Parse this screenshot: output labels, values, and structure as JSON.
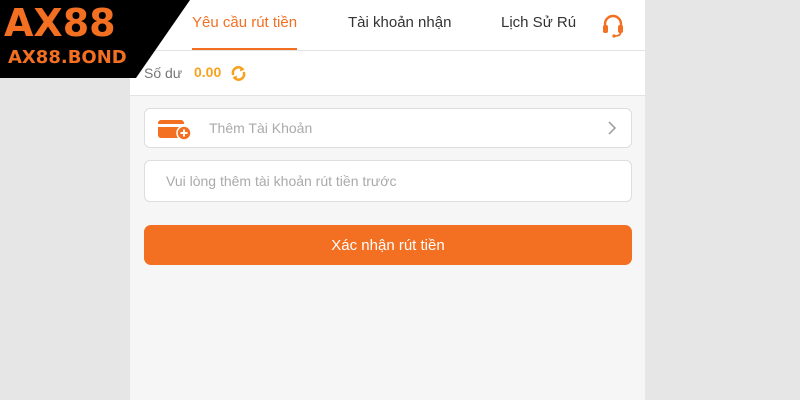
{
  "brand": {
    "logo": "AX88",
    "site": "AX88.BOND"
  },
  "tabs": [
    {
      "label": "Yêu cầu rút tiền",
      "active": true
    },
    {
      "label": "Tài khoản nhận",
      "active": false
    },
    {
      "label": "Lịch Sử Rú",
      "active": false
    }
  ],
  "icons": {
    "support": "headset-icon",
    "refresh": "refresh-icon",
    "card": "card-add-icon",
    "chevron": "chevron-right-icon"
  },
  "balance": {
    "label": "Số dư",
    "value": "0.00"
  },
  "add_account": {
    "label": "Thêm Tài Khoản"
  },
  "note": {
    "placeholder": "Vui lòng thêm tài khoản rút tiền trước",
    "value": ""
  },
  "submit": {
    "label": "Xác nhận rút tiền"
  },
  "colors": {
    "accent": "#f36f21",
    "balance": "#f6a21e",
    "logo_bg": "#000000"
  }
}
